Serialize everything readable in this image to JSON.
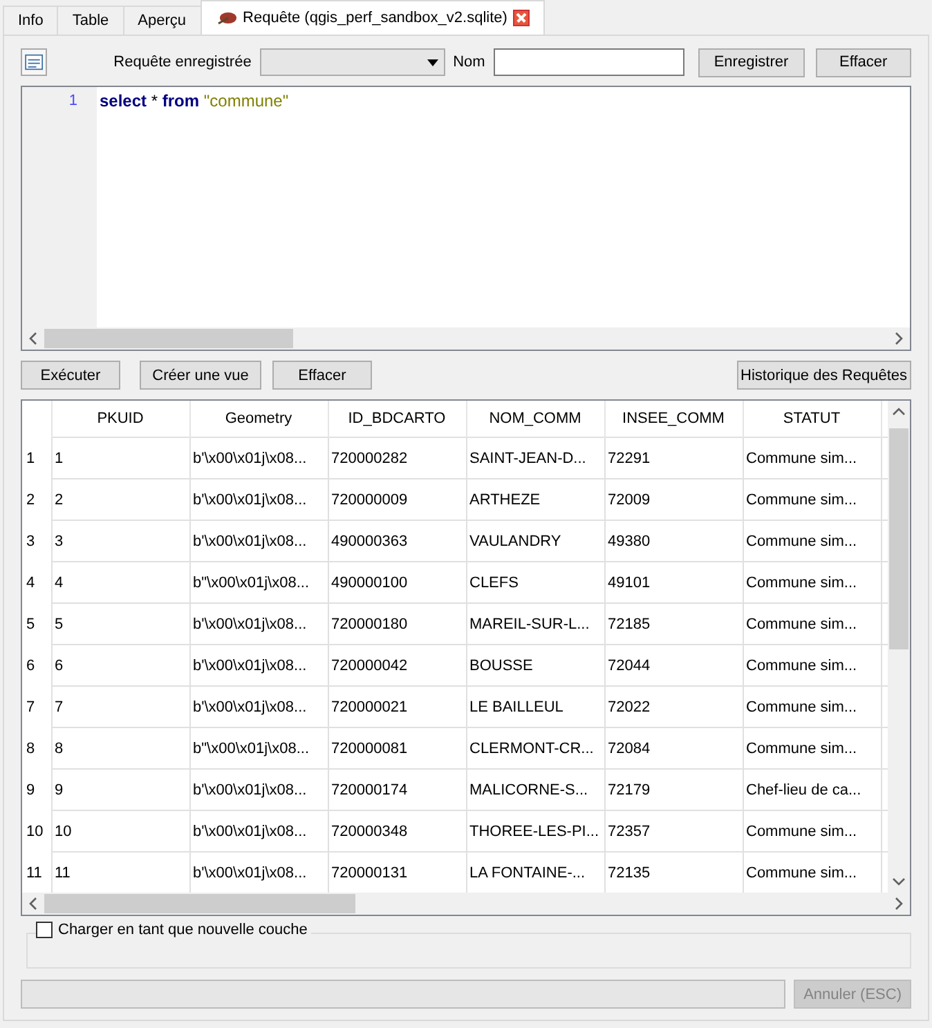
{
  "tabs": [
    {
      "label": "Info",
      "selected": false,
      "closable": false
    },
    {
      "label": "Table",
      "selected": false,
      "closable": false
    },
    {
      "label": "Aperçu",
      "selected": false,
      "closable": false
    },
    {
      "label": "Requête (qgis_perf_sandbox_v2.sqlite)",
      "selected": true,
      "closable": true
    }
  ],
  "toolbar": {
    "saved_query_label": "Requête enregistrée",
    "name_label": "Nom",
    "buttons": [
      "Enregistrer",
      "Effacer"
    ]
  },
  "editor": {
    "lines": [
      {
        "number": "1",
        "tokens": [
          {
            "kind": "keyword",
            "text": "select"
          },
          {
            "kind": "plain",
            "text": "*"
          },
          {
            "kind": "keyword",
            "text": "from"
          },
          {
            "kind": "string",
            "text": "\"commune\""
          }
        ]
      }
    ]
  },
  "actions": {
    "left": [
      "Exécuter",
      "Créer une vue",
      "Effacer"
    ],
    "right": "Historique des Requêtes"
  },
  "table": {
    "columns": [
      "PKUID",
      "Geometry",
      "ID_BDCARTO",
      "NOM_COMM",
      "INSEE_COMM",
      "STATUT"
    ],
    "rows": [
      {
        "header": "1",
        "cells": [
          "1",
          "b'\\x00\\x01j\\x08...",
          "720000282",
          "SAINT-JEAN-D...",
          "72291",
          "Commune sim..."
        ]
      },
      {
        "header": "2",
        "cells": [
          "2",
          "b'\\x00\\x01j\\x08...",
          "720000009",
          "ARTHEZE",
          "72009",
          "Commune sim..."
        ]
      },
      {
        "header": "3",
        "cells": [
          "3",
          "b'\\x00\\x01j\\x08...",
          "490000363",
          "VAULANDRY",
          "49380",
          "Commune sim..."
        ]
      },
      {
        "header": "4",
        "cells": [
          "4",
          "b\"\\x00\\x01j\\x08...",
          "490000100",
          "CLEFS",
          "49101",
          "Commune sim..."
        ]
      },
      {
        "header": "5",
        "cells": [
          "5",
          "b'\\x00\\x01j\\x08...",
          "720000180",
          "MAREIL-SUR-L...",
          "72185",
          "Commune sim..."
        ]
      },
      {
        "header": "6",
        "cells": [
          "6",
          "b'\\x00\\x01j\\x08...",
          "720000042",
          "BOUSSE",
          "72044",
          "Commune sim..."
        ]
      },
      {
        "header": "7",
        "cells": [
          "7",
          "b'\\x00\\x01j\\x08...",
          "720000021",
          "LE BAILLEUL",
          "72022",
          "Commune sim..."
        ]
      },
      {
        "header": "8",
        "cells": [
          "8",
          "b\"\\x00\\x01j\\x08...",
          "720000081",
          "CLERMONT-CR...",
          "72084",
          "Commune sim..."
        ]
      },
      {
        "header": "9",
        "cells": [
          "9",
          "b'\\x00\\x01j\\x08...",
          "720000174",
          "MALICORNE-S...",
          "72179",
          "Chef-lieu de ca..."
        ]
      },
      {
        "header": "10",
        "cells": [
          "10",
          "b'\\x00\\x01j\\x08...",
          "720000348",
          "THOREE-LES-PI...",
          "72357",
          "Commune sim..."
        ]
      },
      {
        "header": "11",
        "cells": [
          "11",
          "b'\\x00\\x01j\\x08...",
          "720000131",
          "LA FONTAINE-...",
          "72135",
          "Commune sim..."
        ]
      }
    ]
  },
  "load_layer": {
    "label": "Charger en tant que nouvelle couche",
    "checked": false
  },
  "progress": {
    "level": 0
  },
  "cancel_button": {
    "label": "Annuler (ESC)",
    "disabled": true
  }
}
